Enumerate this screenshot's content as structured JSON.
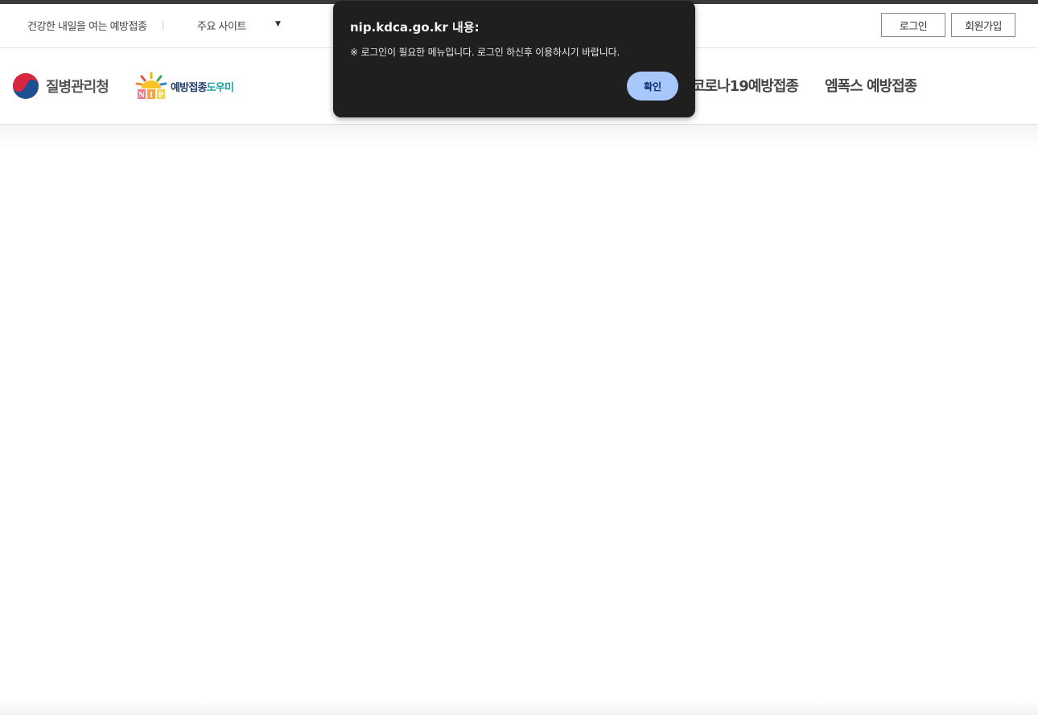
{
  "utility_bar": {
    "slogan": "건강한 내일을 여는 예방접종",
    "site_select": {
      "selected": "주요 사이트",
      "arrow_icon": "triangle-down-icon"
    },
    "login_label": "로그인",
    "join_label": "회원가입"
  },
  "header": {
    "kdca_logo_text": "질병관리청",
    "nip_logo": {
      "badge_text": "NIP",
      "text_primary": "예방접종",
      "text_secondary": "도우미"
    },
    "menu": {
      "covid": "코로나19예방접종",
      "mpox": "엠폭스 예방접종"
    }
  },
  "dialog": {
    "title": "nip.kdca.go.kr 내용:",
    "message": "※ 로그인이 필요한 메뉴입니다. 로그인 하신후 이용하시기 바랍니다.",
    "ok_label": "확인"
  },
  "colors": {
    "dialog_bg": "#1f1f1f",
    "ok_button": "#a8c7fa",
    "nip_primary": "#1e3a6b",
    "nip_secondary": "#18a0a0"
  }
}
